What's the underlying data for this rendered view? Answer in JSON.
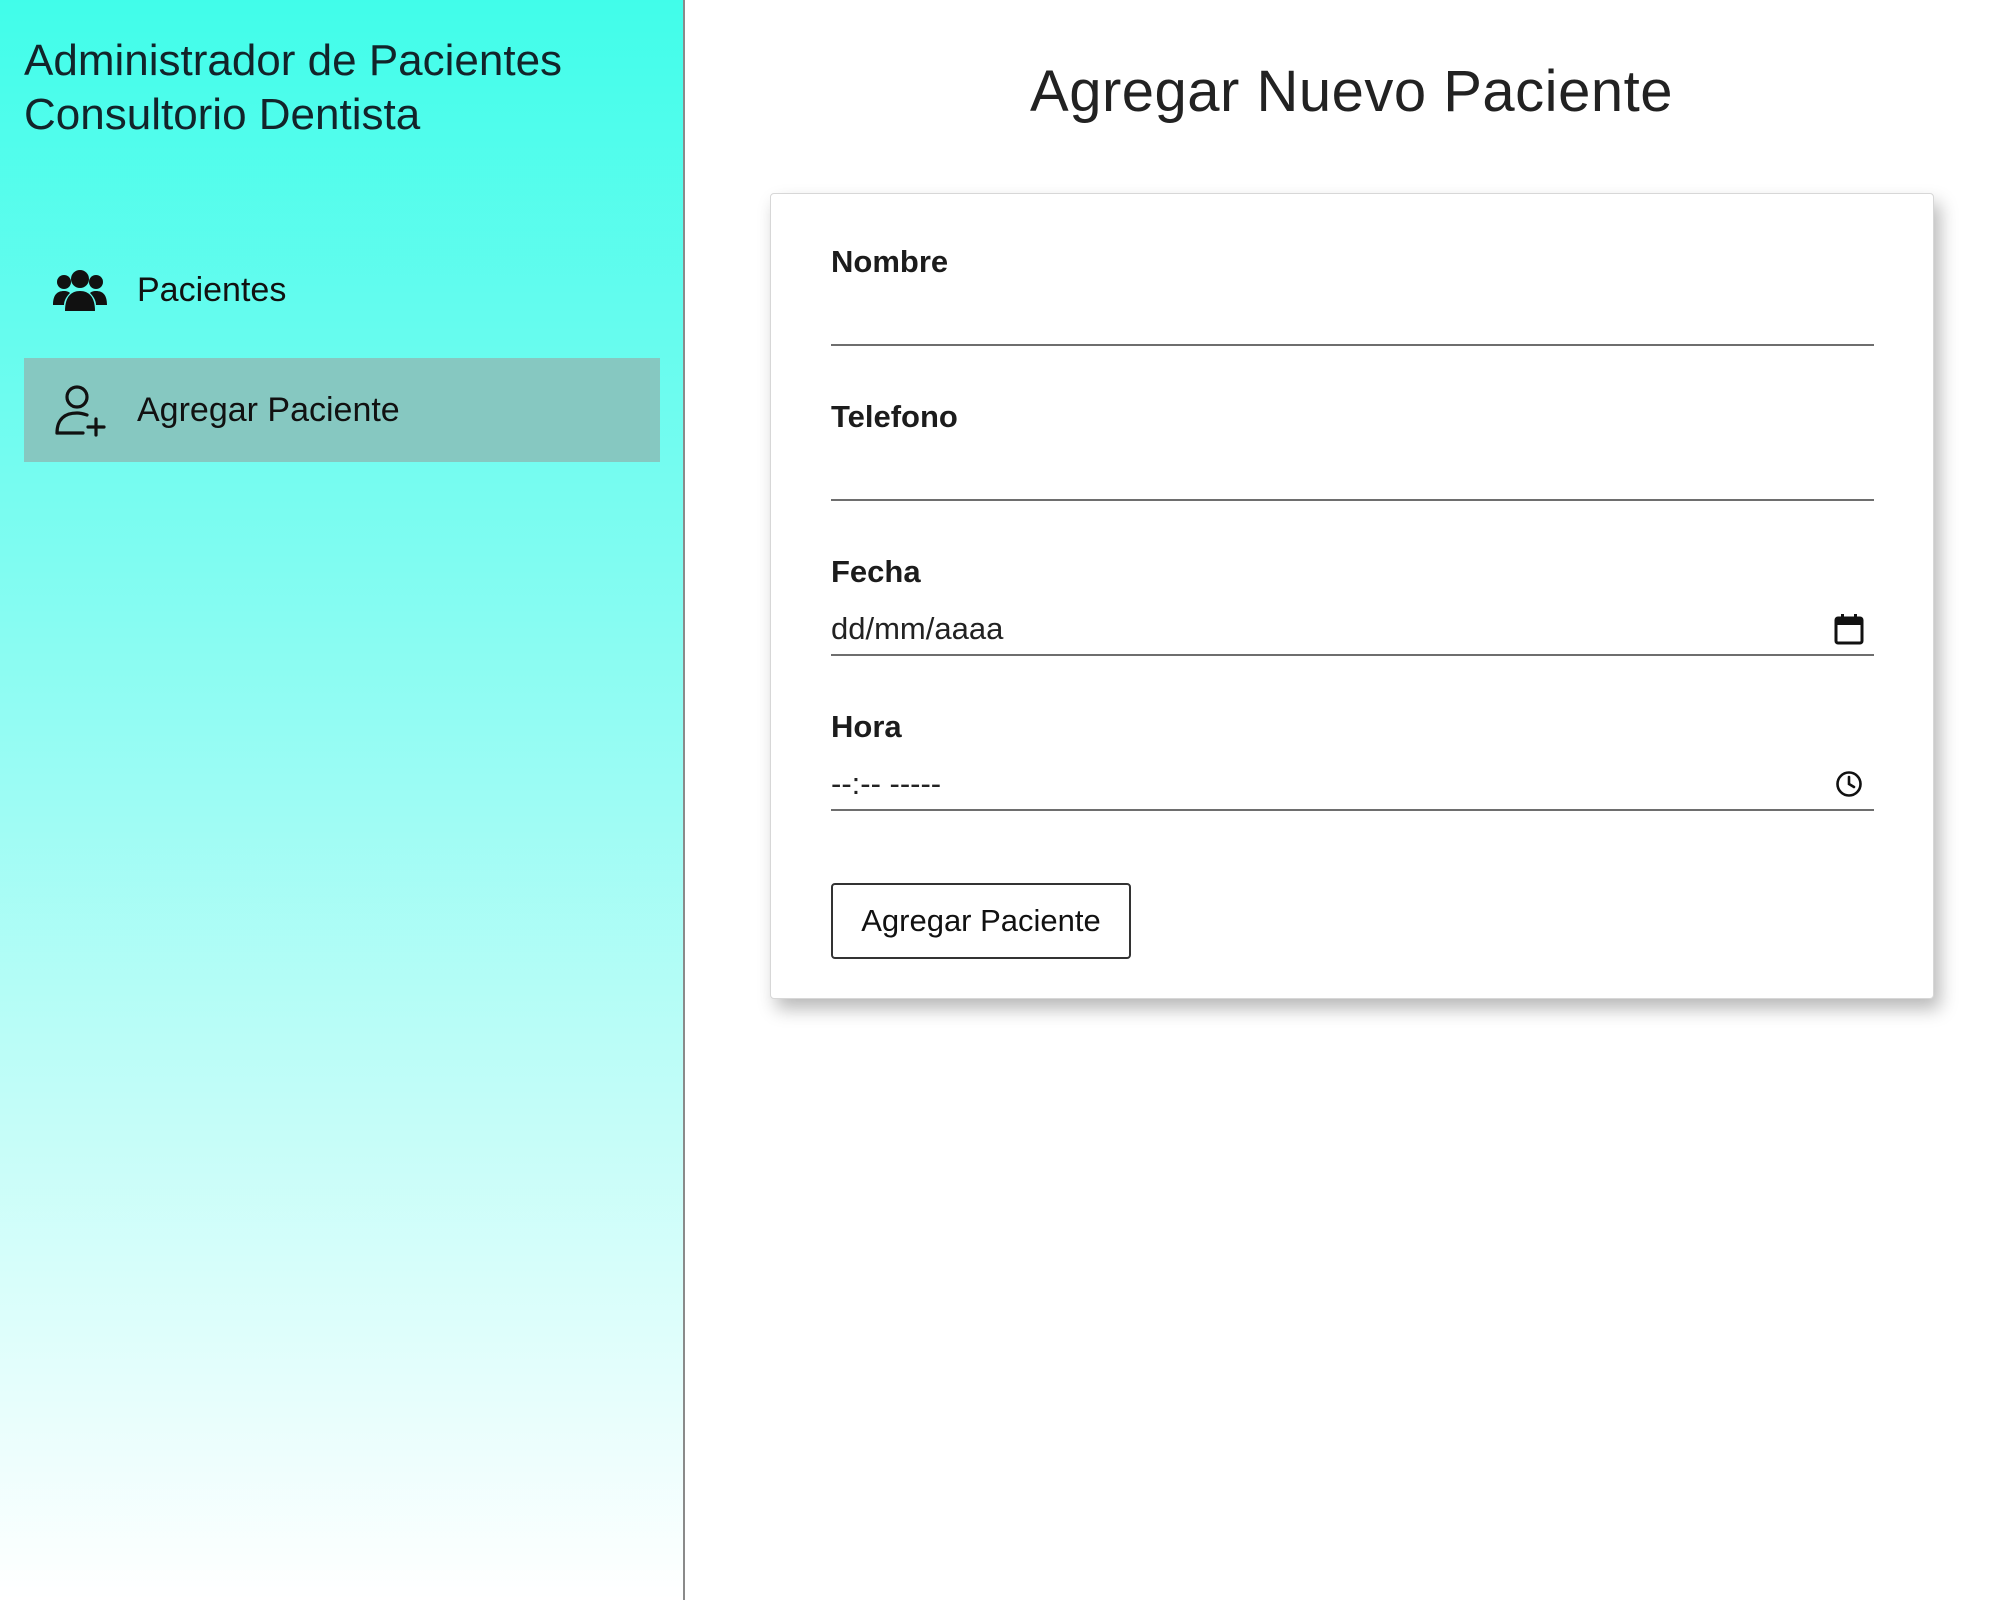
{
  "sidebar": {
    "title_line1": "Administrador de Pacientes",
    "title_line2": "Consultorio Dentista",
    "items": [
      {
        "label": "Pacientes",
        "icon": "users-icon",
        "active": false
      },
      {
        "label": "Agregar Paciente",
        "icon": "user-plus-icon",
        "active": true
      }
    ]
  },
  "main": {
    "title": "Agregar Nuevo Paciente",
    "form": {
      "nombre_label": "Nombre",
      "nombre_value": "",
      "telefono_label": "Telefono",
      "telefono_value": "",
      "fecha_label": "Fecha",
      "fecha_placeholder": "dd/mm/aaaa",
      "hora_label": "Hora",
      "hora_placeholder": "--:-- -----",
      "submit_label": "Agregar Paciente"
    }
  },
  "colors": {
    "sidebar_gradient_top": "#41fdea",
    "sidebar_gradient_bottom": "#ffffff",
    "active_item_bg": "#86c8c1"
  }
}
